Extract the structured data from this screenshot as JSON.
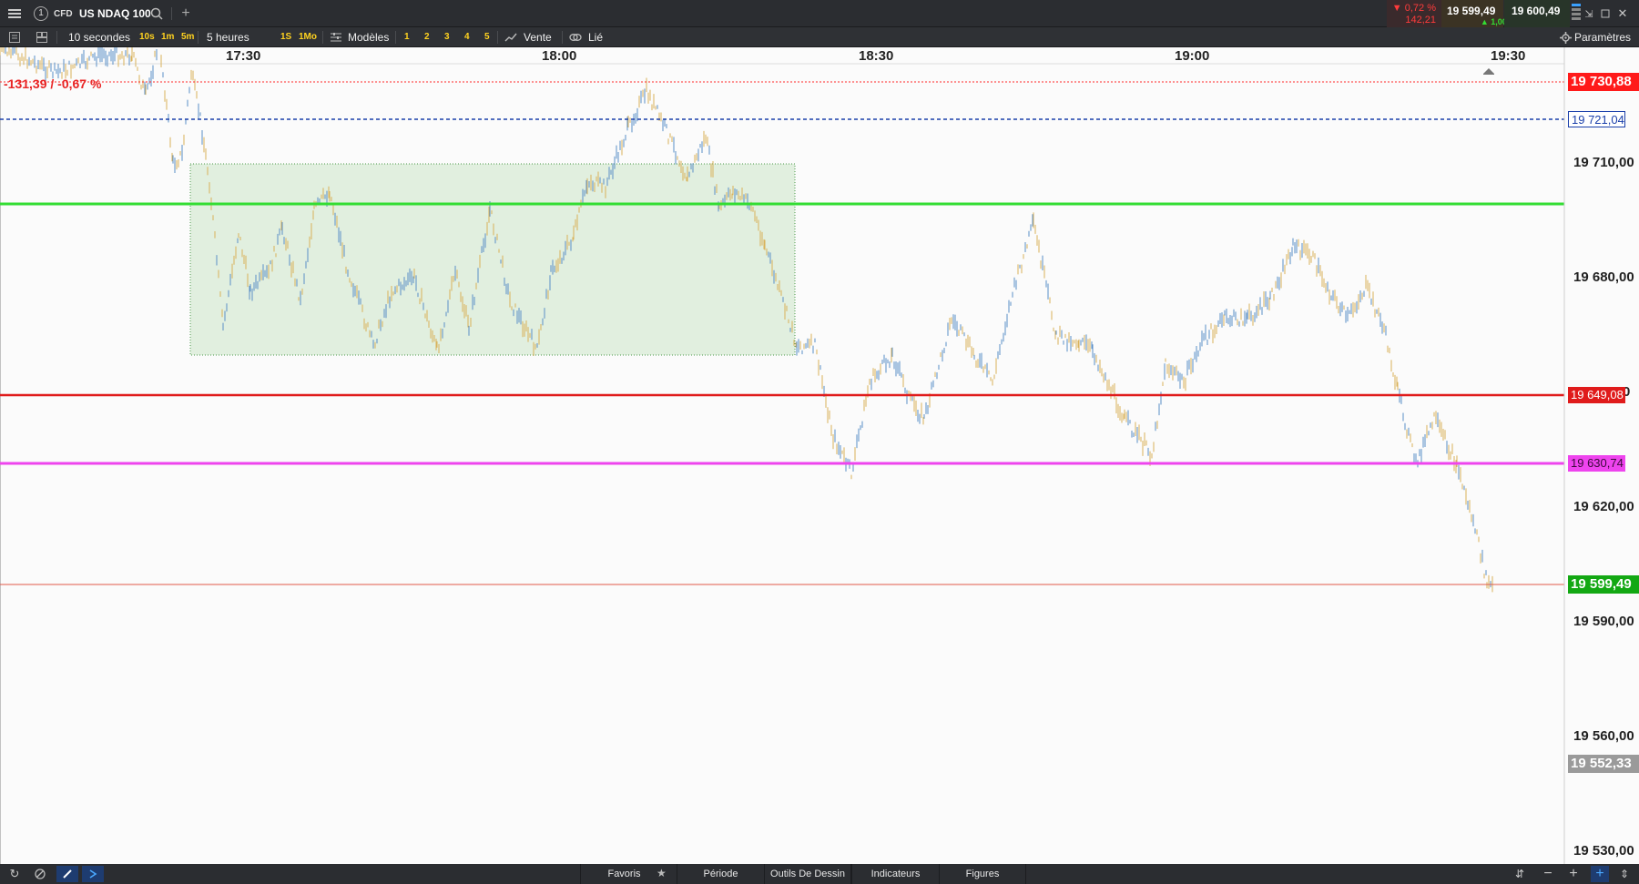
{
  "topbar": {
    "window_badge": "1",
    "instrument_type": "CFD",
    "instrument_name": "US NDAQ 100",
    "change_pct": "▼ 0,72 %",
    "change_abs": "142,21",
    "bid": "19 599,49",
    "spread": "▲ 1,00 ▲",
    "ask": "19 600,49"
  },
  "toolbar": {
    "interval": "10 secondes",
    "quick_intervals": [
      "10s",
      "1m",
      "5m"
    ],
    "period": "5 heures",
    "quick_periods": [
      "1S",
      "1Mo"
    ],
    "models_label": "Modèles",
    "slots": [
      "1",
      "2",
      "3",
      "4",
      "5"
    ],
    "sell_label": "Vente",
    "linked_label": "Lié",
    "settings_label": "Paramètres"
  },
  "chart": {
    "time_labels": [
      "17:30",
      "18:00",
      "18:30",
      "19:00",
      "19:30"
    ],
    "change_text": "-131,39 / -0,67 %",
    "y_axis_labels": [
      "19 710,00",
      "19 680,00",
      "19 620,00",
      "19 590,00",
      "19 560,00",
      "19 530,00"
    ],
    "partial_axis_label": "0",
    "levels": {
      "high": "19 730,88",
      "blue_line": "19 721,04",
      "red_line": "19 649,08",
      "magenta_line": "19 630,74",
      "current": "19 599,49",
      "low": "19 552,33"
    },
    "colors": {
      "high": "#ff1a1a",
      "blue_line": "#1a3faa",
      "green_line": "#33dd33",
      "red_line": "#e01b1b",
      "magenta_line": "#ee44ee",
      "current": "#13a813",
      "low": "#9a9a9a",
      "bull_bar": "#5a8fc7",
      "bear_bar": "#d9b25a"
    }
  },
  "bottombar": {
    "tabs": [
      "Favoris",
      "Période",
      "Outils De Dessin",
      "Indicateurs",
      "Figures"
    ]
  }
}
